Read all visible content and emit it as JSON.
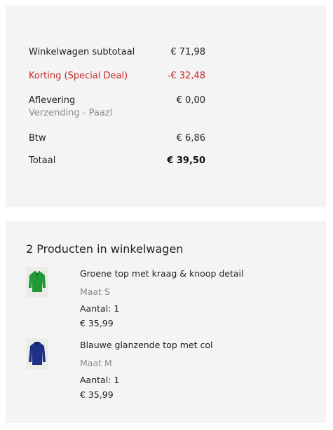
{
  "totals": {
    "subtotal": {
      "label": "Winkelwagen subtotaal",
      "value": "€ 71,98"
    },
    "discount": {
      "label": "Korting (Special Deal)",
      "value": "-€ 32,48"
    },
    "shipping": {
      "label": "Aflevering",
      "sublabel": "Verzending - Paazl",
      "value": "€ 0,00"
    },
    "tax": {
      "label": "Btw",
      "value": "€ 6,86"
    },
    "total": {
      "label": "Totaal",
      "value": "€ 39,50"
    }
  },
  "cart": {
    "title": "2 Producten in winkelwagen",
    "products": [
      {
        "name": "Groene top met kraag & knoop detail",
        "size": "Maat S",
        "quantity": "Aantal: 1",
        "price": "€ 35,99",
        "color": "#1f9a35",
        "icon": "green-top-thumbnail"
      },
      {
        "name": "Blauwe glanzende top met col",
        "size": "Maat M",
        "quantity": "Aantal: 1",
        "price": "€ 35,99",
        "color": "#1f2f86",
        "icon": "blue-top-thumbnail"
      }
    ]
  },
  "colors": {
    "panel_bg": "#f4f4f4",
    "discount": "#c62828",
    "muted": "#8a8a8a"
  }
}
